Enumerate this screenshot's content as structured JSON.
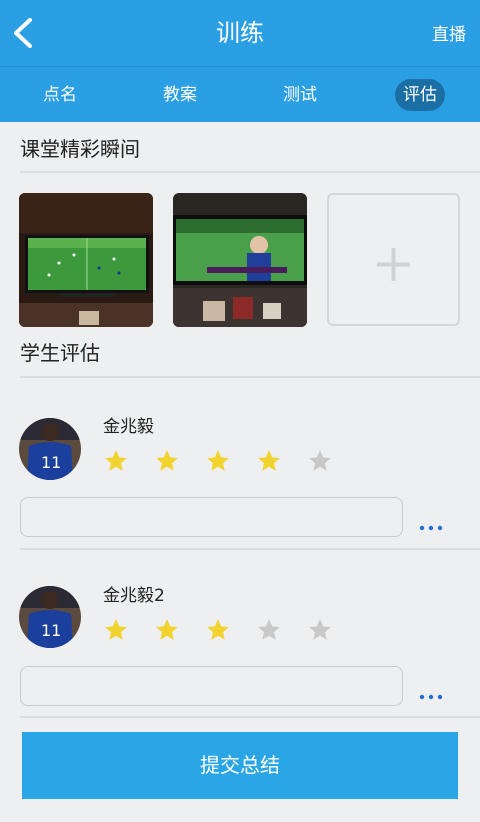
{
  "header": {
    "title": "训练",
    "live_label": "直播"
  },
  "tabs": [
    {
      "label": "点名",
      "active": false
    },
    {
      "label": "教案",
      "active": false
    },
    {
      "label": "测试",
      "active": false
    },
    {
      "label": "评估",
      "active": true
    }
  ],
  "moments": {
    "title": "课堂精彩瞬间"
  },
  "evaluation": {
    "title": "学生评估"
  },
  "students": [
    {
      "name": "金兆毅",
      "rating": 4,
      "max_rating": 5,
      "comment": ""
    },
    {
      "name": "金兆毅2",
      "rating": 3,
      "max_rating": 5,
      "comment": ""
    }
  ],
  "submit_label": "提交总结",
  "colors": {
    "primary": "#2a9fe4",
    "active_tab": "#1b6fa5",
    "star_on": "#f2d22c",
    "star_off": "#c8c8c8",
    "more_dots": "#1f6fd6"
  },
  "icons": {
    "back": "chevron-left-icon",
    "add": "plus-icon",
    "star": "star-icon",
    "more": "ellipsis-icon"
  }
}
